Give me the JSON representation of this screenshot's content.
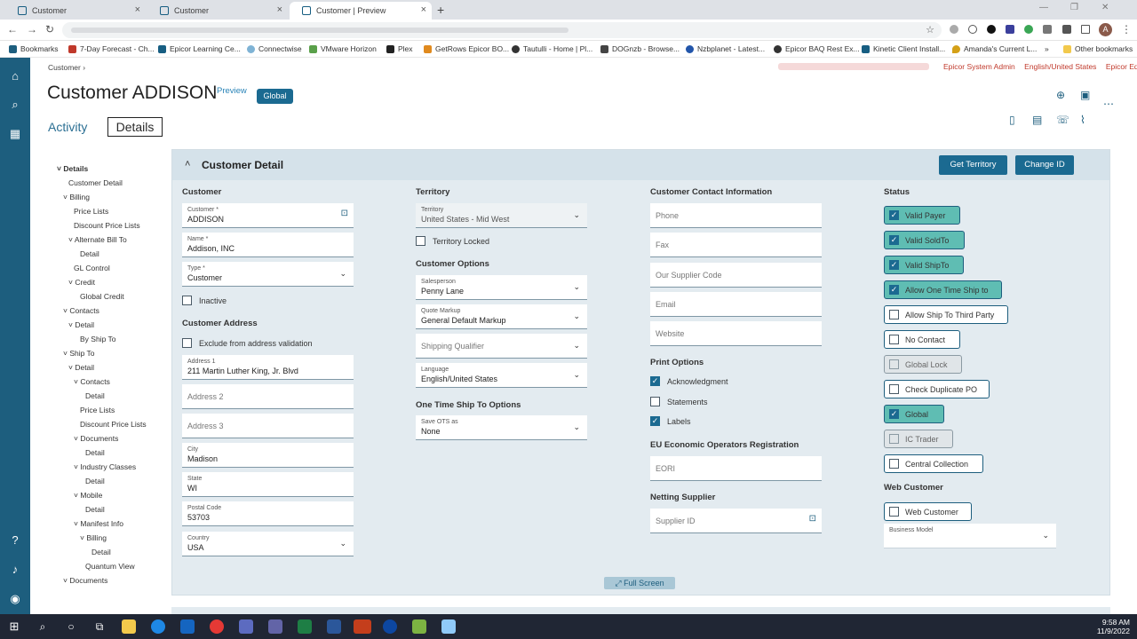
{
  "browser": {
    "tabs": [
      {
        "label": "Customer"
      },
      {
        "label": "Customer"
      },
      {
        "label": "Customer | Preview"
      }
    ],
    "bookmarks": [
      "Bookmarks",
      "7-Day Forecast - Ch...",
      "Epicor Learning Ce...",
      "Connectwise",
      "VMware Horizon",
      "Plex",
      "GetRows Epicor BO...",
      "Tautulli - Home | Pl...",
      "DOGnzb - Browse...",
      "Nzbplanet - Latest...",
      "Epicor BAQ Rest Ex...",
      "Kinetic Client Install...",
      "Amanda's Current L...",
      "Other bookmarks"
    ],
    "avatar_letter": "A"
  },
  "app": {
    "breadcrumb": "Customer",
    "user_info": [
      "Epicor System Admin",
      "English/United States",
      "Epicor Education"
    ],
    "title": "Customer ADDISON",
    "preview_label": "Preview",
    "global_badge": "Global",
    "tabs": {
      "activity": "Activity",
      "details": "Details"
    }
  },
  "tree": [
    "Details",
    "Customer Detail",
    "Billing",
    "Price Lists",
    "Discount Price Lists",
    "Alternate Bill To",
    "Detail",
    "GL Control",
    "Credit",
    "Global Credit",
    "Contacts",
    "Detail",
    "By Ship To",
    "Ship To",
    "Detail",
    "Contacts",
    "Detail",
    "Price Lists",
    "Discount Price Lists",
    "Documents",
    "Detail",
    "Industry Classes",
    "Detail",
    "Mobile",
    "Detail",
    "Manifest Info",
    "Billing",
    "Detail",
    "Quantum View",
    "Documents"
  ],
  "panel": {
    "title": "Customer Detail",
    "get_territory": "Get Territory",
    "change_id": "Change ID",
    "customer": {
      "section": "Customer",
      "customer_label": "Customer *",
      "customer_value": "ADDISON",
      "name_label": "Name *",
      "name_value": "Addison, INC",
      "type_label": "Type *",
      "type_value": "Customer",
      "inactive": "Inactive"
    },
    "address": {
      "section": "Customer Address",
      "exclude": "Exclude from address validation",
      "address1_label": "Address 1",
      "address1_value": "211 Martin Luther King, Jr. Blvd",
      "address2_ph": "Address 2",
      "address3_ph": "Address 3",
      "city_label": "City",
      "city_value": "Madison",
      "state_label": "State",
      "state_value": "WI",
      "postal_label": "Postal Code",
      "postal_value": "53703",
      "country_label": "Country",
      "country_value": "USA"
    },
    "territory": {
      "section": "Territory",
      "territory_label": "Territory",
      "territory_value": "United States - Mid West",
      "locked": "Territory Locked"
    },
    "options": {
      "section": "Customer Options",
      "salesperson_label": "Salesperson",
      "salesperson_value": "Penny Lane",
      "markup_label": "Quote Markup",
      "markup_value": "General Default Markup",
      "shipping_ph": "Shipping Qualifier",
      "language_label": "Language",
      "language_value": "English/United States"
    },
    "otst": {
      "section": "One Time Ship To Options",
      "save_label": "Save OTS as",
      "save_value": "None"
    },
    "contact": {
      "section": "Customer Contact Information",
      "phone": "Phone",
      "fax": "Fax",
      "supplier_code": "Our Supplier Code",
      "email": "Email",
      "website": "Website"
    },
    "print": {
      "section": "Print Options",
      "ack": "Acknowledgment",
      "statements": "Statements",
      "labels": "Labels"
    },
    "eu": {
      "section": "EU Economic Operators Registration",
      "eori": "EORI"
    },
    "netting": {
      "section": "Netting Supplier",
      "supplier_id": "Supplier ID"
    },
    "status": {
      "section": "Status",
      "items": [
        {
          "label": "Valid Payer",
          "checked": true
        },
        {
          "label": "Valid SoldTo",
          "checked": true
        },
        {
          "label": "Valid ShipTo",
          "checked": true
        },
        {
          "label": "Allow One Time Ship to",
          "checked": true
        },
        {
          "label": "Allow Ship To Third Party",
          "checked": false
        },
        {
          "label": "No Contact",
          "checked": false
        },
        {
          "label": "Global Lock",
          "checked": false,
          "disabled": true
        },
        {
          "label": "Check Duplicate PO",
          "checked": false
        },
        {
          "label": "Global",
          "checked": true
        },
        {
          "label": "IC Trader",
          "checked": false,
          "disabled": true
        },
        {
          "label": "Central Collection",
          "checked": false
        }
      ]
    },
    "web": {
      "section": "Web Customer",
      "web_customer": "Web Customer",
      "business_model_label": "Business Model"
    },
    "full_screen": "Full Screen"
  },
  "taskbar": {
    "time": "9:58 AM",
    "date": "11/9/2022"
  },
  "colors": {
    "rail": "#1d5e7e",
    "button": "#1b6a91",
    "checked_toggle": "#5fbdb3"
  }
}
